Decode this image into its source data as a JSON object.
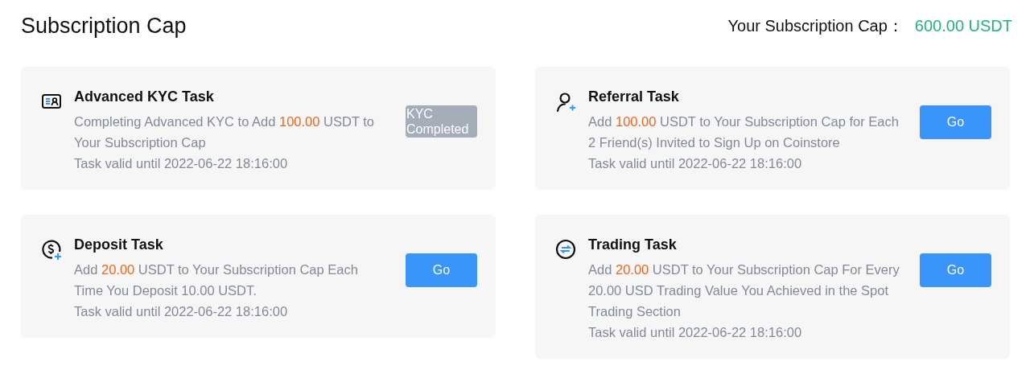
{
  "header": {
    "title": "Subscription Cap",
    "cap_label": "Your Subscription Cap：",
    "cap_value": "600.00 USDT"
  },
  "tasks": [
    {
      "kind": "kyc",
      "title": "Advanced KYC Task",
      "description": {
        "before": "Completing Advanced KYC to Add ",
        "amount": "100.00",
        "after": " USDT to Your Subscription Cap"
      },
      "validity": "Task valid until 2022-06-22 18:16:00",
      "button": {
        "label": "KYC Completed",
        "disabled": true
      }
    },
    {
      "kind": "referral",
      "title": "Referral Task",
      "description": {
        "before": "Add ",
        "amount": "100.00",
        "after": " USDT to Your Subscription Cap for Each 2 Friend(s) Invited to Sign Up on Coinstore"
      },
      "validity": "Task valid until 2022-06-22 18:16:00",
      "button": {
        "label": "Go",
        "disabled": false
      }
    },
    {
      "kind": "deposit",
      "title": "Deposit Task",
      "description": {
        "before": "Add ",
        "amount": "20.00",
        "after": " USDT to Your Subscription Cap Each Time You Deposit 10.00 USDT."
      },
      "validity": "Task valid until 2022-06-22 18:16:00",
      "button": {
        "label": "Go",
        "disabled": false
      }
    },
    {
      "kind": "trading",
      "title": "Trading Task",
      "description": {
        "before": "Add ",
        "amount": "20.00",
        "after": " USDT to Your Subscription Cap For Every 20.00 USD Trading Value You Achieved in the Spot Trading Section"
      },
      "validity": "Task valid until 2022-06-22 18:16:00",
      "button": {
        "label": "Go",
        "disabled": false
      }
    }
  ]
}
